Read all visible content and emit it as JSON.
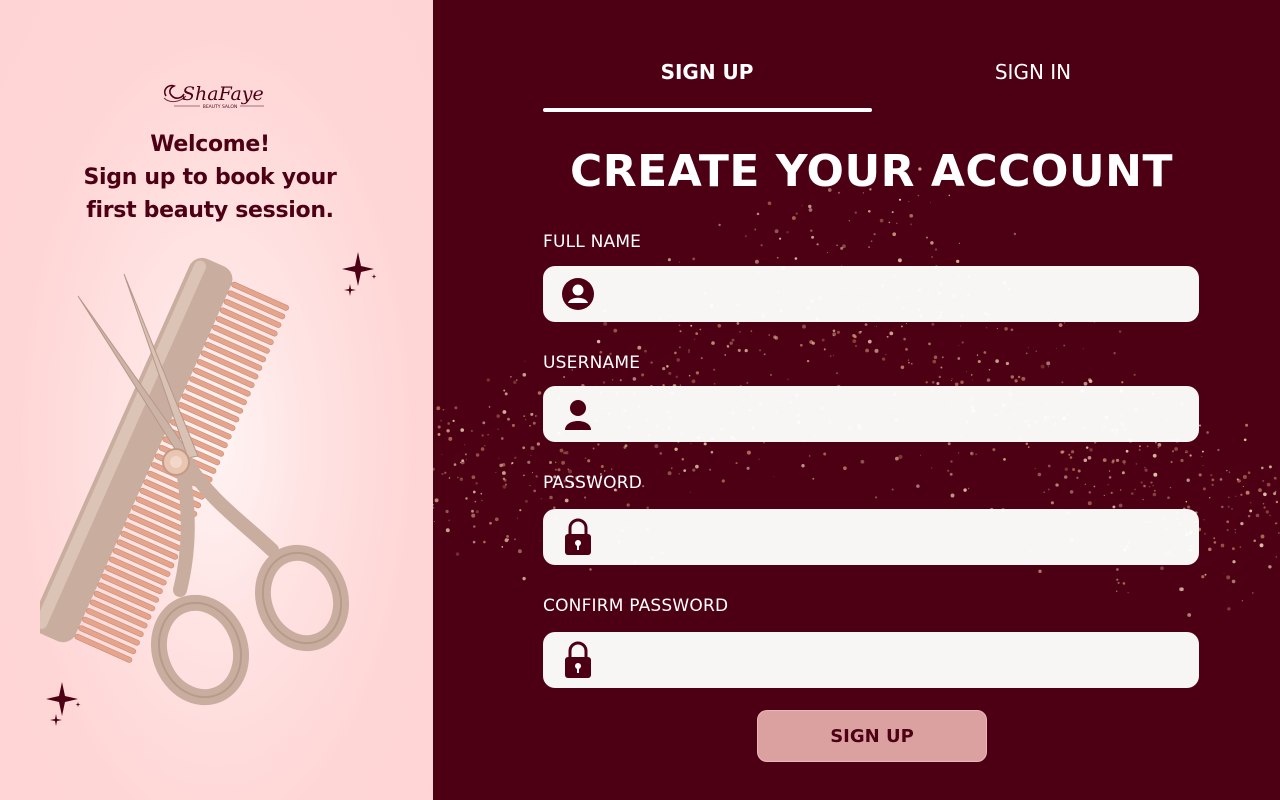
{
  "brand": {
    "logo_text": "ShaFaye",
    "logo_subtext": "BEAUTY SALON"
  },
  "welcome": {
    "line1": "Welcome!",
    "line2": "Sign up to book your",
    "line3": "first beauty session."
  },
  "tabs": [
    {
      "label": "SIGN UP",
      "active": true
    },
    {
      "label": "SIGN IN",
      "active": false
    }
  ],
  "form": {
    "title": "CREATE YOUR ACCOUNT",
    "fields": [
      {
        "label": "FULL NAME",
        "value": "",
        "icon": "user-circle-icon"
      },
      {
        "label": "USERNAME",
        "value": "",
        "icon": "user-icon"
      },
      {
        "label": "PASSWORD",
        "value": "",
        "icon": "lock-icon"
      },
      {
        "label": "CONFIRM PASSWORD",
        "value": "",
        "icon": "lock-icon"
      }
    ],
    "submit_label": "SIGN UP"
  },
  "colors": {
    "primary": "#4d0014",
    "left_bg": "#ffd6d6",
    "button_bg": "#dba1a1",
    "comb": "#c9aea0",
    "teeth": "#e4a58c"
  }
}
